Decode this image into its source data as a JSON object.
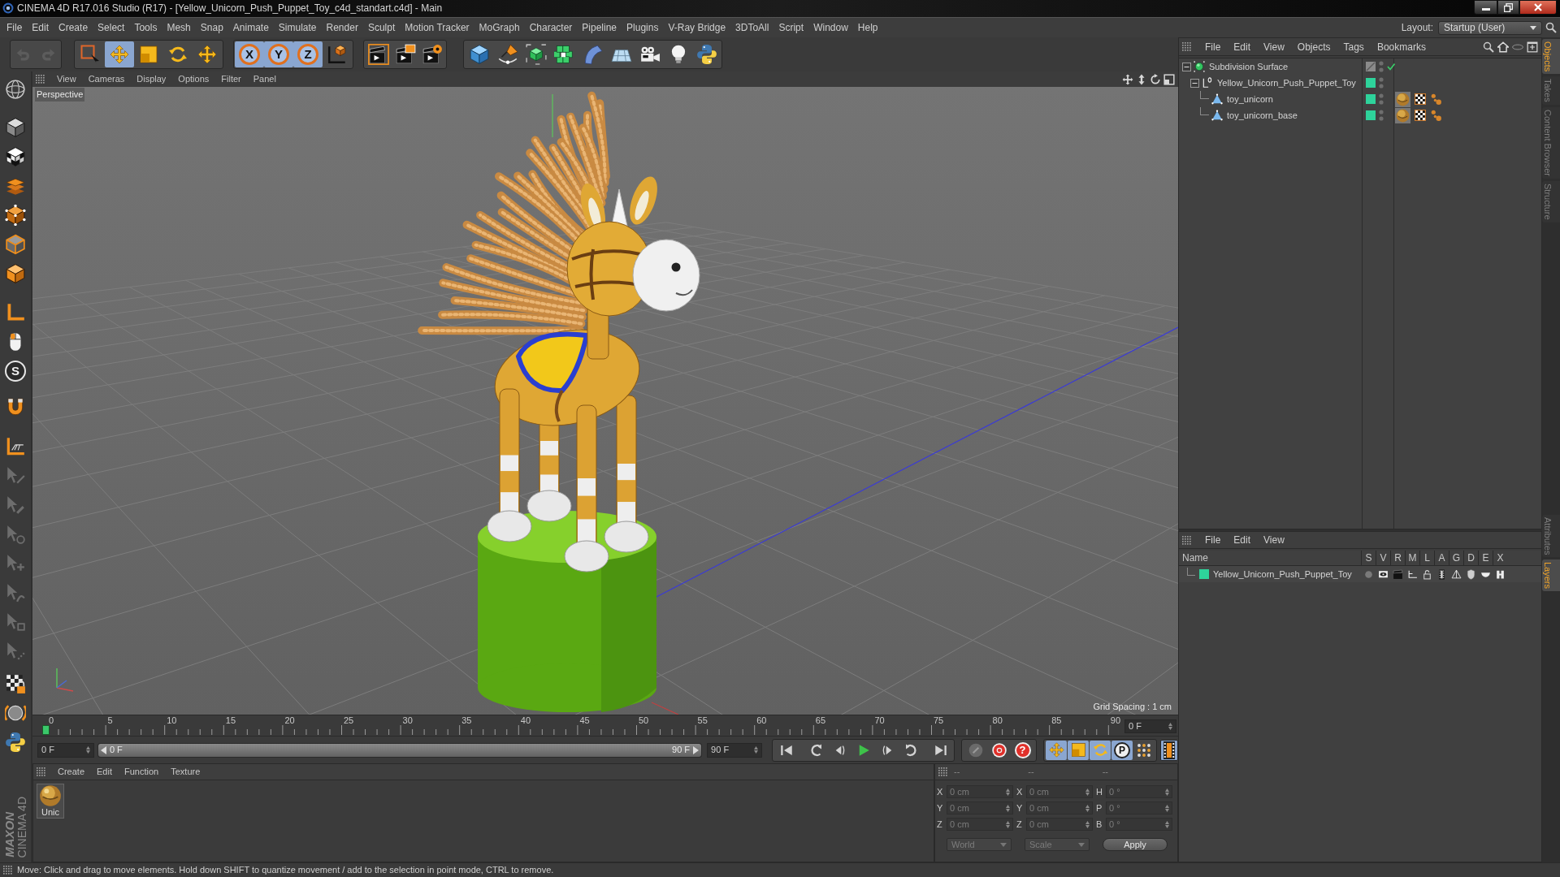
{
  "window": {
    "title": "CINEMA 4D R17.016 Studio (R17) - [Yellow_Unicorn_Push_Puppet_Toy_c4d_standart.c4d] - Main"
  },
  "menu_bar": {
    "items": [
      "File",
      "Edit",
      "Create",
      "Select",
      "Tools",
      "Mesh",
      "Snap",
      "Animate",
      "Simulate",
      "Render",
      "Sculpt",
      "Motion Tracker",
      "MoGraph",
      "Character",
      "Pipeline",
      "Plugins",
      "V-Ray Bridge",
      "3DToAll",
      "Script",
      "Window",
      "Help"
    ],
    "layout_label": "Layout:",
    "layout_value": "Startup (User)"
  },
  "toolbar": {
    "history": [
      {
        "disabled": true
      },
      {
        "disabled": true
      }
    ],
    "tools": [
      {
        "selected": false
      },
      {
        "selected": true
      },
      {
        "selected": false
      },
      {
        "selected": false
      },
      {
        "selected": false
      }
    ],
    "axis_locks": [
      {
        "label": "X",
        "on": true
      },
      {
        "label": "Y",
        "on": true
      },
      {
        "label": "Z",
        "on": true
      }
    ]
  },
  "left_toolbar": [
    {
      "disabled": false
    },
    {
      "disabled": false
    },
    {
      "disabled": false
    },
    {
      "disabled": false
    },
    {
      "disabled": false
    },
    {
      "disabled": false
    },
    {
      "disabled": false
    },
    {
      "disabled": false
    },
    {
      "disabled": false
    },
    {
      "disabled": false,
      "label": "S"
    },
    {
      "disabled": false
    },
    {
      "disabled": false
    },
    {
      "disabled": true
    },
    {
      "disabled": true
    },
    {
      "disabled": true
    },
    {
      "disabled": true
    },
    {
      "disabled": true
    },
    {
      "disabled": true
    },
    {
      "disabled": true
    },
    {
      "disabled": false
    },
    {
      "disabled": false
    },
    {
      "disabled": false
    }
  ],
  "viewport": {
    "menu": [
      "View",
      "Cameras",
      "Display",
      "Options",
      "Filter",
      "Panel"
    ],
    "camera": "Perspective",
    "grid_spacing": "Grid Spacing : 1 cm"
  },
  "timeline": {
    "ticks": [
      "0",
      "5",
      "10",
      "15",
      "20",
      "25",
      "30",
      "35",
      "40",
      "45",
      "50",
      "55",
      "60",
      "65",
      "70",
      "75",
      "80",
      "85",
      "90"
    ],
    "current_frame": "0 F",
    "start": "0 F",
    "range": {
      "start": "0 F",
      "end": "90 F",
      "level": 1
    },
    "end": "90 F",
    "record": [
      {
        "disabled": true
      },
      {
        "disabled": false
      },
      {
        "disabled": false,
        "label": "?"
      }
    ],
    "key_toggles": [
      {
        "on": true
      },
      {
        "on": true
      },
      {
        "on": true
      },
      {
        "on": true,
        "label": "P"
      },
      {
        "on": false
      }
    ],
    "timeline_view": {
      "on": true
    }
  },
  "logo": {
    "brand": "MAXON",
    "product": "CINEMA 4D"
  },
  "materials": {
    "menu": [
      "Create",
      "Edit",
      "Function",
      "Texture"
    ],
    "items": [
      {
        "name": "Unic"
      }
    ]
  },
  "coordinates": {
    "disabled": true,
    "headers": [
      "--",
      "--",
      "--"
    ],
    "rows": [
      [
        {
          "axis": "X",
          "value": "0 cm"
        },
        {
          "axis": "X",
          "value": "0 cm"
        },
        {
          "axis": "H",
          "value": "0 °"
        }
      ],
      [
        {
          "axis": "Y",
          "value": "0 cm"
        },
        {
          "axis": "Y",
          "value": "0 cm"
        },
        {
          "axis": "P",
          "value": "0 °"
        }
      ],
      [
        {
          "axis": "Z",
          "value": "0 cm"
        },
        {
          "axis": "Z",
          "value": "0 cm"
        },
        {
          "axis": "B",
          "value": "0 °"
        }
      ]
    ],
    "dropdowns": [
      "World",
      "Scale"
    ],
    "apply": "Apply"
  },
  "object_manager": {
    "menu": [
      "File",
      "Edit",
      "View",
      "Objects",
      "Tags",
      "Bookmarks"
    ],
    "objects": [
      {
        "name": "Subdivision Surface",
        "kind": "subdivision",
        "expanded": true,
        "enabled": true,
        "children": [
          {
            "name": "Yellow_Unicorn_Push_Puppet_Toy",
            "kind": "null",
            "expanded": true,
            "color": "#2ed39b",
            "children": [
              {
                "name": "toy_unicorn",
                "kind": "polygon",
                "color": "#2ed39b",
                "tagged": true
              },
              {
                "name": "toy_unicorn_base",
                "kind": "polygon",
                "color": "#2ed39b",
                "tagged": true
              }
            ]
          }
        ]
      }
    ]
  },
  "layer_manager": {
    "menu": [
      "File",
      "Edit",
      "View"
    ],
    "columns": [
      "Name",
      "S",
      "V",
      "R",
      "M",
      "L",
      "A",
      "G",
      "D",
      "E",
      "X"
    ],
    "layers": [
      {
        "name": "Yellow_Unicorn_Push_Puppet_Toy",
        "color": "#2ed39b"
      }
    ]
  },
  "side_tabs": {
    "top": [
      {
        "label": "Objects",
        "selected": true
      },
      {
        "label": "Takes",
        "selected": false
      },
      {
        "label": "Content Browser",
        "selected": false
      },
      {
        "label": "Structure",
        "selected": false
      }
    ],
    "bottom": [
      {
        "label": "Attributes",
        "selected": false
      },
      {
        "label": "Layers",
        "selected": true
      }
    ]
  },
  "status_bar": {
    "text": "Move: Click and drag to move elements. Hold down SHIFT to quantize movement / add to the selection in point mode, CTRL to remove."
  }
}
